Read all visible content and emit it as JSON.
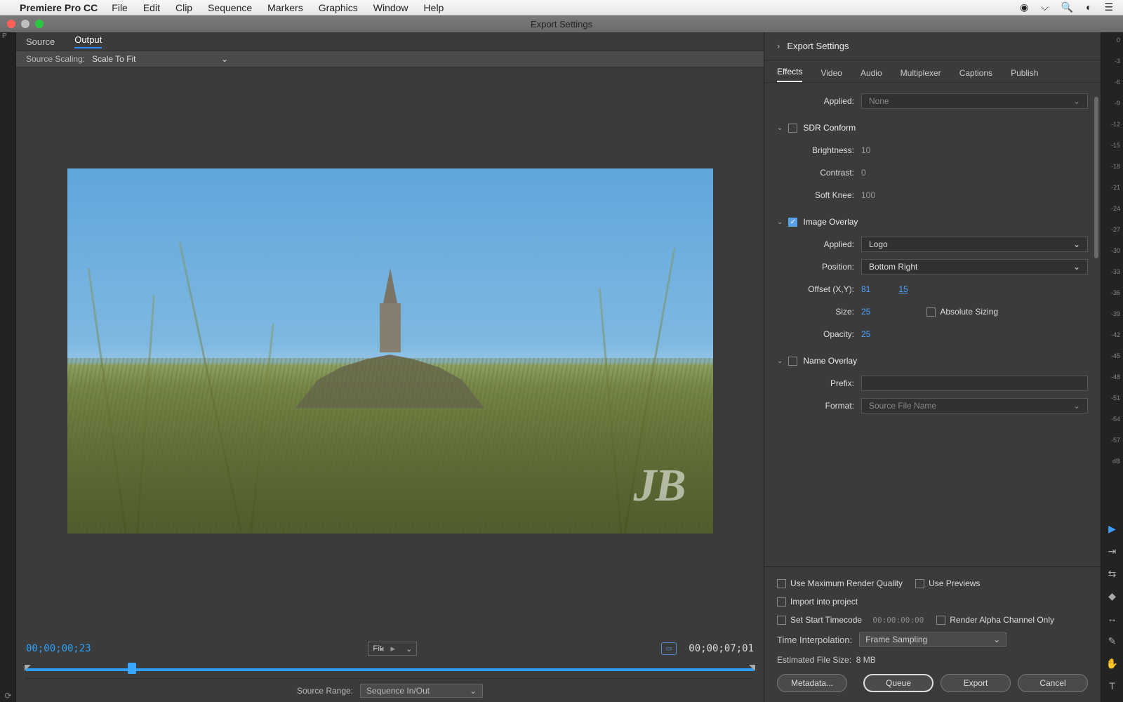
{
  "menubar": {
    "apple": "",
    "app_name": "Premiere Pro CC",
    "items": [
      "File",
      "Edit",
      "Clip",
      "Sequence",
      "Markers",
      "Graphics",
      "Window",
      "Help"
    ]
  },
  "window": {
    "title": "Export Settings"
  },
  "preview": {
    "tabs": {
      "source": "Source",
      "output": "Output"
    },
    "scaling_label": "Source Scaling:",
    "scaling_value": "Scale To Fit",
    "watermark": "JB",
    "tc_in": "00;00;00;23",
    "tc_out": "00;00;07;01",
    "fit_label": "Fit",
    "source_range_label": "Source Range:",
    "source_range_value": "Sequence In/Out"
  },
  "export": {
    "header": "Export Settings",
    "tabs": [
      "Effects",
      "Video",
      "Audio",
      "Multiplexer",
      "Captions",
      "Publish"
    ],
    "applied_label": "Applied:",
    "applied_value": "None",
    "sdr": {
      "title": "SDR Conform",
      "brightness_label": "Brightness:",
      "brightness_val": "10",
      "contrast_label": "Contrast:",
      "contrast_val": "0",
      "softknee_label": "Soft Knee:",
      "softknee_val": "100"
    },
    "overlay": {
      "title": "Image Overlay",
      "applied_label": "Applied:",
      "applied_val": "Logo",
      "position_label": "Position:",
      "position_val": "Bottom Right",
      "offset_label": "Offset (X,Y):",
      "offset_x": "81",
      "offset_y": "15",
      "size_label": "Size:",
      "size_val": "25",
      "abs_label": "Absolute Sizing",
      "opacity_label": "Opacity:",
      "opacity_val": "25"
    },
    "name_overlay": {
      "title": "Name Overlay",
      "prefix_label": "Prefix:",
      "format_label": "Format:",
      "format_val": "Source File Name"
    }
  },
  "footer": {
    "max_quality": "Use Maximum Render Quality",
    "use_previews": "Use Previews",
    "import_project": "Import into project",
    "set_start_tc": "Set Start Timecode",
    "start_tc_val": "00:00:00:00",
    "render_alpha": "Render Alpha Channel Only",
    "interp_label": "Time Interpolation:",
    "interp_val": "Frame Sampling",
    "est_label": "Estimated File Size:",
    "est_val": "8 MB",
    "metadata_btn": "Metadata...",
    "queue_btn": "Queue",
    "export_btn": "Export",
    "cancel_btn": "Cancel"
  },
  "db_marks": [
    "0",
    "-3",
    "-6",
    "-9",
    "-12",
    "-15",
    "-18",
    "-21",
    "-24",
    "-27",
    "-30",
    "-33",
    "-36",
    "-39",
    "-42",
    "-45",
    "-48",
    "-51",
    "-54",
    "-57",
    "dB"
  ]
}
